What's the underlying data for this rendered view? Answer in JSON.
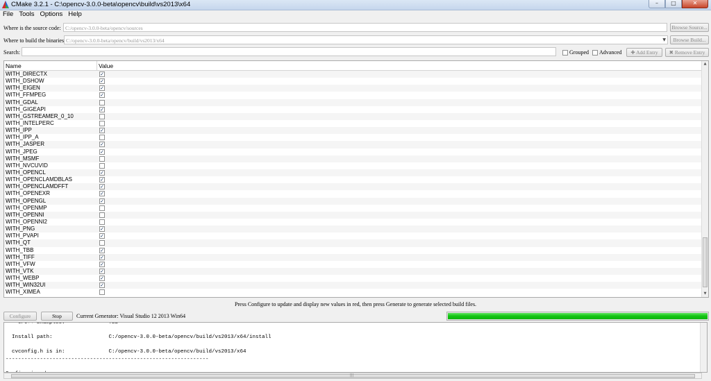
{
  "window": {
    "title": "CMake 3.2.1 - C:\\opencv-3.0.0-beta\\opencv\\build\\vs2013\\x64",
    "minimize": "–",
    "maximize": "□",
    "close": "✕"
  },
  "menu": [
    "File",
    "Tools",
    "Options",
    "Help"
  ],
  "source": {
    "label": "Where is the source code:",
    "value": "C:/opencv-3.0.0-beta/opencv/sources",
    "button": "Browse Source..."
  },
  "binaries": {
    "label": "Where to build the binaries:",
    "value": "C:/opencv-3.0.0-beta/opencv/build/vs2013/x64",
    "button": "Browse Build..."
  },
  "search": {
    "label": "Search:",
    "value": "",
    "grouped": "Grouped",
    "advanced": "Advanced",
    "add_entry": "Add Entry",
    "remove_entry": "Remove Entry"
  },
  "table": {
    "headers": [
      "Name",
      "Value"
    ],
    "rows": [
      {
        "name": "WITH_DIRECTX",
        "checked": true
      },
      {
        "name": "WITH_DSHOW",
        "checked": true
      },
      {
        "name": "WITH_EIGEN",
        "checked": true
      },
      {
        "name": "WITH_FFMPEG",
        "checked": true
      },
      {
        "name": "WITH_GDAL",
        "checked": false
      },
      {
        "name": "WITH_GIGEAPI",
        "checked": true
      },
      {
        "name": "WITH_GSTREAMER_0_10",
        "checked": false
      },
      {
        "name": "WITH_INTELPERC",
        "checked": false
      },
      {
        "name": "WITH_IPP",
        "checked": true
      },
      {
        "name": "WITH_IPP_A",
        "checked": false
      },
      {
        "name": "WITH_JASPER",
        "checked": true
      },
      {
        "name": "WITH_JPEG",
        "checked": true
      },
      {
        "name": "WITH_MSMF",
        "checked": false
      },
      {
        "name": "WITH_NVCUVID",
        "checked": false
      },
      {
        "name": "WITH_OPENCL",
        "checked": true
      },
      {
        "name": "WITH_OPENCLAMDBLAS",
        "checked": true
      },
      {
        "name": "WITH_OPENCLAMDFFT",
        "checked": true
      },
      {
        "name": "WITH_OPENEXR",
        "checked": true
      },
      {
        "name": "WITH_OPENGL",
        "checked": true
      },
      {
        "name": "WITH_OPENMP",
        "checked": false
      },
      {
        "name": "WITH_OPENNI",
        "checked": false
      },
      {
        "name": "WITH_OPENNI2",
        "checked": false
      },
      {
        "name": "WITH_PNG",
        "checked": true
      },
      {
        "name": "WITH_PVAPI",
        "checked": true
      },
      {
        "name": "WITH_QT",
        "checked": false
      },
      {
        "name": "WITH_TBB",
        "checked": true
      },
      {
        "name": "WITH_TIFF",
        "checked": true
      },
      {
        "name": "WITH_VFW",
        "checked": true
      },
      {
        "name": "WITH_VTK",
        "checked": true
      },
      {
        "name": "WITH_WEBP",
        "checked": true
      },
      {
        "name": "WITH_WIN32UI",
        "checked": true
      },
      {
        "name": "WITH_XIMEA",
        "checked": false
      }
    ]
  },
  "hint": "Press Configure to update and display new values in red, then press Generate to generate selected build files.",
  "actions": {
    "configure": "Configure",
    "stop": "Stop",
    "generator": "Current Generator: Visual Studio 12 2013 Win64"
  },
  "progress": 1.0,
  "output": [
    "    C/C++ Examples:              YES",
    "",
    "  Install path:                  C:/opencv-3.0.0-beta/opencv/build/vs2013/x64/install",
    "",
    "  cvconfig.h is in:              C:/opencv-3.0.0-beta/opencv/build/vs2013/x64",
    "-----------------------------------------------------------------",
    "",
    "Configuring done"
  ],
  "colors": {
    "progress": "#12c412",
    "title_bar": "#c5d6ec"
  }
}
